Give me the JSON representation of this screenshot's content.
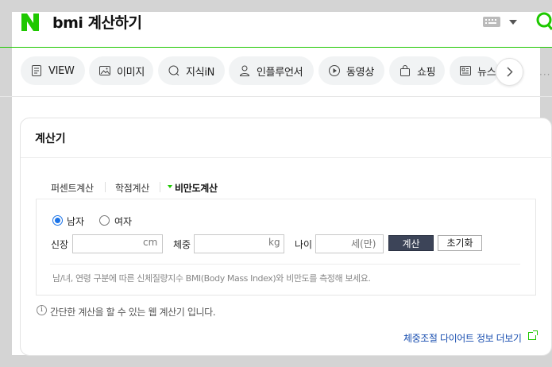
{
  "header": {
    "query": "bmi 계산하기"
  },
  "tabs": [
    {
      "label": "VIEW",
      "icon": "view-icon"
    },
    {
      "label": "이미지",
      "icon": "image-icon"
    },
    {
      "label": "지식iN",
      "icon": "kin-icon"
    },
    {
      "label": "인플루언서",
      "icon": "person-icon"
    },
    {
      "label": "동영상",
      "icon": "play-icon"
    },
    {
      "label": "쇼핑",
      "icon": "bag-icon"
    },
    {
      "label": "뉴스",
      "icon": "news-icon"
    }
  ],
  "more": "···",
  "card": {
    "title": "계산기",
    "calc_tabs": [
      "퍼센트계산",
      "학점계산",
      "비만도계산"
    ],
    "gender": {
      "male": "남자",
      "female": "여자",
      "selected": "남자"
    },
    "fields": {
      "height_label": "신장",
      "height_unit": "cm",
      "weight_label": "체중",
      "weight_unit": "kg",
      "age_label": "나이",
      "age_unit": "세(만)"
    },
    "calc_button": "계산",
    "reset_button": "초기화",
    "description": "남/녀, 연령 구분에 따른 신체질량지수 BMI(Body Mass Index)와 비만도를 측정해 보세요.",
    "info": "간단한 계산을 할 수 있는 웹 계산기 입니다.",
    "info_icon": "i",
    "more_link": "체중조절 다이어트 정보 더보기"
  },
  "colors": {
    "brand_green": "#1ec800",
    "button_dark": "#3c4458",
    "link_blue": "#1a4fb0",
    "radio_blue": "#1a73e8"
  }
}
